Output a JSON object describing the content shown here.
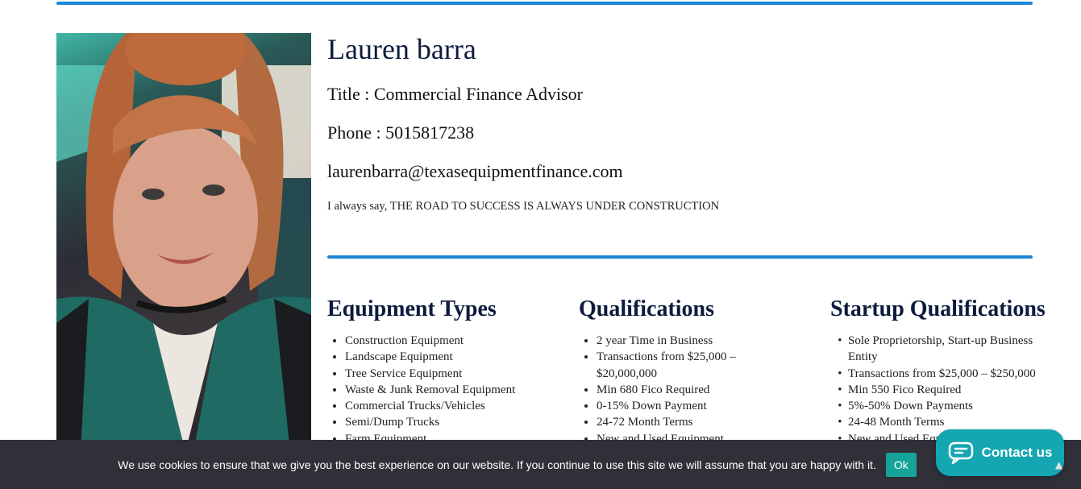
{
  "profile": {
    "name": "Lauren barra",
    "title": "Title : Commercial Finance Advisor",
    "phone": "Phone : 5015817238",
    "email": "laurenbarra@texasequipmentfinance.com",
    "quote": "I always say, THE ROAD TO SUCCESS IS ALWAYS UNDER CONSTRUCTION"
  },
  "columns": [
    {
      "heading": "Equipment Types",
      "items": [
        "Construction Equipment",
        "Landscape Equipment",
        "Tree Service Equipment",
        "Waste & Junk Removal Equipment",
        "Commercial Trucks/Vehicles",
        "Semi/Dump Trucks",
        "Farm Equipment"
      ]
    },
    {
      "heading": "Qualifications",
      "items": [
        "2 year Time in Business",
        "Transactions from $25,000 – $20,000,000",
        "Min 680 Fico Required",
        "0-15% Down Payment",
        "24-72 Month Terms",
        "New and Used Equipment"
      ]
    },
    {
      "heading": "Startup Qualifications",
      "items": [
        "Sole Proprietorship, Start-up Business Entity",
        "Transactions from $25,000 – $250,000",
        "Min 550 Fico Required",
        "5%-50% Down Payments",
        "24-48 Month Terms",
        "New and Used Equipment"
      ]
    }
  ],
  "cookie": {
    "text": "We use cookies to ensure that we give you the best experience on our website. If you continue to use this site we will assume that you are happy with it.",
    "ok_label": "Ok"
  },
  "contact": {
    "label": "Contact us",
    "icon": "chat-bubble-icon"
  },
  "colors": {
    "accent_rule": "#1b87d6",
    "heading": "#0d1b3d",
    "cookie_bg": "#2f3038",
    "ok_button": "#15a39a",
    "contact_button": "#14a7b1"
  }
}
